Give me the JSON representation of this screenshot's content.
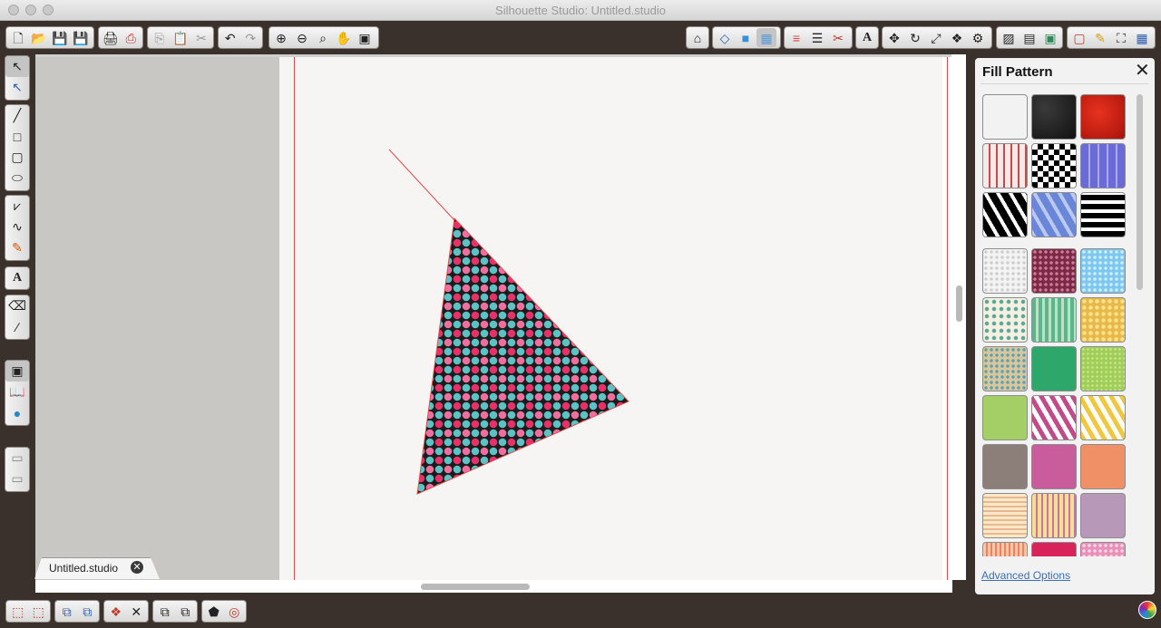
{
  "window": {
    "title": "Silhouette Studio: Untitled.studio"
  },
  "document_tab": {
    "label": "Untitled.studio"
  },
  "panel": {
    "title": "Fill Pattern",
    "advanced_options": "Advanced Options"
  },
  "colors": {
    "window_bg": "#3a302c",
    "page_bg": "#f6f5f4",
    "canvas_gray": "#c9c7c4",
    "cut_line": "#e84a4a",
    "link": "#3a6fb7",
    "pattern_black": "#1c1c1c",
    "dot_pink": "#e8306a",
    "dot_light_pink": "#ef6ea0",
    "dot_teal": "#5bc3c3"
  },
  "toolbar_icons": [
    "new-document-icon",
    "open-folder-icon",
    "save-icon",
    "save-to-library-icon",
    "print-icon",
    "print-cut-icon",
    "copy-icon",
    "paste-icon",
    "cut-icon",
    "undo-icon",
    "redo-icon",
    "zoom-in-icon",
    "zoom-out-icon",
    "zoom-select-icon",
    "pan-icon",
    "fit-page-icon",
    "design-store-icon",
    "fill-color-icon",
    "fill-gradient-icon",
    "fill-pattern-icon",
    "line-color-icon",
    "line-style-icon",
    "cut-settings-icon",
    "text-style-icon",
    "transform-icon",
    "rotate-icon",
    "scale-icon",
    "replicate-icon",
    "page-setup-icon",
    "registration-icon",
    "library-icon",
    "offset-icon",
    "trace-icon",
    "crop-icon",
    "grid-icon"
  ],
  "left_tools": [
    "select-icon",
    "point-edit-icon",
    "line-icon",
    "rectangle-icon",
    "rounded-rectangle-icon",
    "ellipse-icon",
    "polygon-icon",
    "curve-icon",
    "freehand-icon",
    "text-icon",
    "eraser-icon",
    "knife-icon",
    "show-library-icon",
    "library-book-icon",
    "silhouette-store-icon",
    "panel-toggle-icon"
  ],
  "bottom_tools": [
    "group-icon",
    "ungroup-icon",
    "make-compound-icon",
    "release-compound-icon",
    "duplicate-icon",
    "delete-icon",
    "bring-forward-icon",
    "send-backward-icon",
    "weld-icon",
    "offset-icon"
  ],
  "patterns": [
    "white-crosshatch",
    "black-leather",
    "red-crinkle",
    "red-arrows",
    "black-white-checker",
    "purple-geometric",
    "black-diamonds",
    "blue-diamonds",
    "black-white-stripes",
    "white-dots",
    "burgundy-dots",
    "sky-blue-dots",
    "teal-argyle",
    "green-stripes",
    "yellow-dots",
    "blue-tan-dots",
    "emerald-green",
    "lime-speckle",
    "lime-green",
    "pink-harlequin",
    "yellow-harlequin",
    "taupe",
    "rose",
    "salmon",
    "cream-stripes",
    "pink-yellow-stripes",
    "mauve",
    "peach-stripes",
    "raspberry",
    "pink-dots"
  ]
}
